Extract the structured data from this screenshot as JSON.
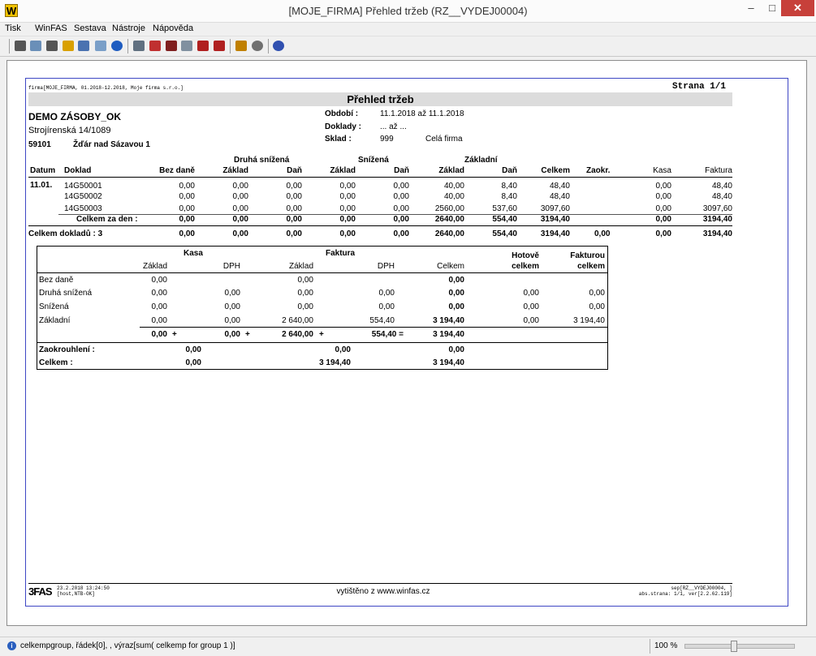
{
  "window": {
    "title": "[MOJE_FIRMA] Přehled tržeb (RZ__VYDEJ00004)",
    "app_icon": "W",
    "minimize": "–",
    "maximize": "□",
    "close": "✕"
  },
  "menu": [
    "Tisk",
    "WinFAS",
    "Sestava",
    "Nástroje",
    "Nápověda"
  ],
  "report": {
    "firm_line": "firma[MOJE_FIRMA, 01.2018-12.2018, Moje firma s.r.o.]",
    "page": "Strana 1/1",
    "title": "Přehled tržeb",
    "company": "DEMO ZÁSOBY_OK",
    "street": "Strojírenská 14/1089",
    "zip": "59101",
    "city": "Žďár nad Sázavou 1",
    "period_label": "Období :",
    "period_value": "11.1.2018  až  11.1.2018",
    "docs_label": "Doklady :",
    "docs_value": "...  až ...",
    "store_label": "Sklad :",
    "store_code": "999",
    "store_name": "Celá firma",
    "groups": {
      "druha": "Druhá snížená",
      "snizena": "Snížená",
      "zakladni": "Základní"
    },
    "headers": [
      "Datum",
      "Doklad",
      "Bez daně",
      "Základ",
      "Daň",
      "Základ",
      "Daň",
      "Základ",
      "Daň",
      "Celkem",
      "Zaokr.",
      "Kasa",
      "Faktura"
    ],
    "date": "11.01.",
    "rows": [
      [
        "14G50001",
        "0,00",
        "0,00",
        "0,00",
        "0,00",
        "0,00",
        "40,00",
        "8,40",
        "48,40",
        "",
        "0,00",
        "48,40"
      ],
      [
        "14G50002",
        "0,00",
        "0,00",
        "0,00",
        "0,00",
        "0,00",
        "40,00",
        "8,40",
        "48,40",
        "",
        "0,00",
        "48,40"
      ],
      [
        "14G50003",
        "0,00",
        "0,00",
        "0,00",
        "0,00",
        "0,00",
        "2560,00",
        "537,60",
        "3097,60",
        "",
        "0,00",
        "3097,60"
      ]
    ],
    "day_total": [
      "Celkem za den :",
      "0,00",
      "0,00",
      "0,00",
      "0,00",
      "0,00",
      "2640,00",
      "554,40",
      "3194,40",
      "",
      "0,00",
      "3194,40"
    ],
    "doc_total": [
      "Celkem dokladů : 3",
      "0,00",
      "0,00",
      "0,00",
      "0,00",
      "0,00",
      "2640,00",
      "554,40",
      "3194,40",
      "0,00",
      "0,00",
      "3194,40"
    ]
  },
  "summary": {
    "kasa": "Kasa",
    "faktura": "Faktura",
    "hotove_1": "Hotově",
    "hotove_2": "celkem",
    "fakturou_1": "Fakturou",
    "fakturou_2": "celkem",
    "subheaders": [
      "Základ",
      "DPH",
      "Základ",
      "DPH",
      "Celkem"
    ],
    "rows": [
      [
        "Bez daně",
        "0,00",
        "",
        "0,00",
        "",
        "0,00",
        "",
        ""
      ],
      [
        "Druhá snížená",
        "0,00",
        "0,00",
        "0,00",
        "0,00",
        "0,00",
        "0,00",
        "0,00"
      ],
      [
        "Snížená",
        "0,00",
        "0,00",
        "0,00",
        "0,00",
        "0,00",
        "0,00",
        "0,00"
      ],
      [
        "Základní",
        "0,00",
        "0,00",
        "2 640,00",
        "554,40",
        "3 194,40",
        "0,00",
        "3 194,40"
      ]
    ],
    "totals": [
      "0,00",
      "+",
      "0,00",
      "+",
      "2 640,00",
      "+",
      "554,40 =",
      "3 194,40"
    ],
    "rounding_label": "Zaokrouhlení :",
    "rounding": [
      "0,00",
      "0,00",
      "0,00"
    ],
    "total_label": "Celkem :",
    "total": [
      "0,00",
      "3 194,40",
      "3 194,40"
    ]
  },
  "footer": {
    "logo": "FAS",
    "logo_prefix": "3",
    "timestamp": "23.2.2018 13:24:50",
    "host": "[host,NTB-OK]",
    "printed": "vytištěno z www.winfas.cz",
    "sep_line": "sep[RZ__VYDEJ00004, ]",
    "page_info": "abs.strana: 1/1,    ver[2.2.62.119]"
  },
  "status": {
    "text": "celkempgroup, řádek[0], , výraz[sum( celkemp for group 1 )]",
    "zoom": "100 %"
  }
}
